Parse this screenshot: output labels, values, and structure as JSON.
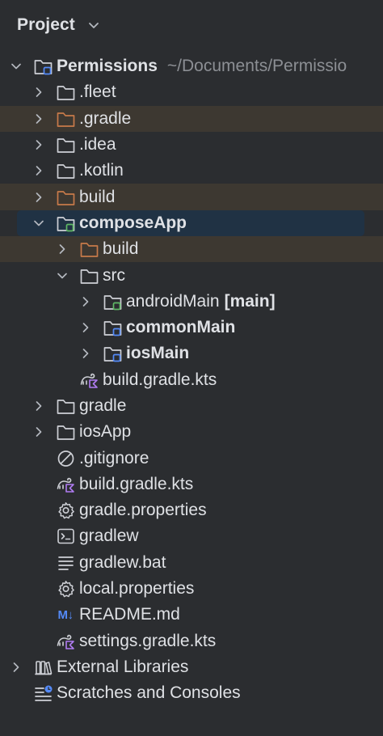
{
  "header": {
    "title": "Project"
  },
  "colors": {
    "background": "#2b2d30",
    "excluded_row": "#3d3831",
    "selected_row": "#203244",
    "folder_orange": "#c77a4a",
    "module_green": "#5fb865",
    "module_blue": "#548af7",
    "kotlin_purple": "#b07cf2"
  },
  "tree": {
    "root": {
      "label": "Permissions",
      "path": "~/Documents/Permissio"
    },
    "items": [
      {
        "label": ".fleet"
      },
      {
        "label": ".gradle"
      },
      {
        "label": ".idea"
      },
      {
        "label": ".kotlin"
      },
      {
        "label": "build"
      },
      {
        "label": "composeApp"
      },
      {
        "label": "build"
      },
      {
        "label": "src"
      },
      {
        "label": "androidMain",
        "suffix": "[main]"
      },
      {
        "label": "commonMain"
      },
      {
        "label": "iosMain"
      },
      {
        "label": "build.gradle.kts"
      },
      {
        "label": "gradle"
      },
      {
        "label": "iosApp"
      },
      {
        "label": ".gitignore"
      },
      {
        "label": "build.gradle.kts"
      },
      {
        "label": "gradle.properties"
      },
      {
        "label": "gradlew"
      },
      {
        "label": "gradlew.bat"
      },
      {
        "label": "local.properties"
      },
      {
        "label": "README.md",
        "icon_text": "M↓"
      },
      {
        "label": "settings.gradle.kts"
      },
      {
        "label": "External Libraries"
      },
      {
        "label": "Scratches and Consoles"
      }
    ]
  }
}
